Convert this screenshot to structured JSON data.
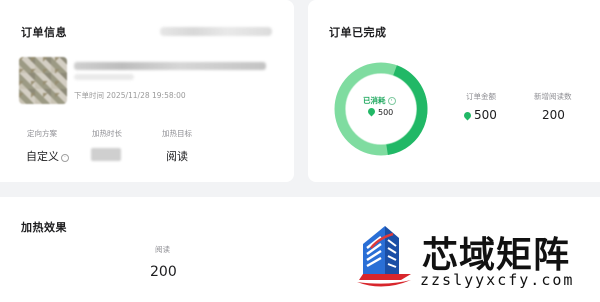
{
  "order_info": {
    "title": "订单信息",
    "order_time": "下单时间 2025/11/28 19:58:00",
    "meta": [
      {
        "label": "定向方案",
        "value": "自定义"
      },
      {
        "label": "加热时长",
        "value": ""
      },
      {
        "label": "加热目标",
        "value": "阅读"
      }
    ]
  },
  "order_complete": {
    "title": "订单已完成",
    "consumed_label": "已消耗",
    "consumed_value": "500",
    "progress": 1.0,
    "stats": [
      {
        "label": "订单金额",
        "value": "500"
      },
      {
        "label": "新增阅读数",
        "value": "200"
      }
    ]
  },
  "heat_effect": {
    "title": "加热效果",
    "reads_label": "阅读",
    "reads_value": "200"
  },
  "watermark": {
    "title": "芯域矩阵",
    "url": "zzslyyxcfy.com"
  },
  "colors": {
    "accent_green": "#21b866",
    "ring_light": "#7fdca0",
    "logo_blue": "#2a6fd6",
    "logo_red": "#d8262c"
  },
  "icons": {
    "info": "info-circle-icon",
    "coin": "coin-icon",
    "logo": "building-logo-icon"
  }
}
